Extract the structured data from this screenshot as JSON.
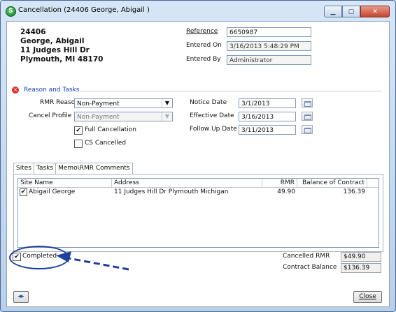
{
  "window": {
    "title": "Cancellation (24406 George, Abigail )",
    "app_icon_glyph": "S",
    "minimize_glyph": "▁",
    "maximize_glyph": "▢",
    "close_glyph": "✕"
  },
  "customer": {
    "id": "24406",
    "name": "George, Abigail",
    "address1": "11  Judges Hill Dr",
    "address2": "Plymouth, MI  48170"
  },
  "info": {
    "reference_label": "Reference",
    "reference_value": "6650987",
    "entered_on_label": "Entered On",
    "entered_on_value": "3/16/2013 5:48:29 PM",
    "entered_by_label": "Entered By",
    "entered_by_value": "Administrator"
  },
  "section": {
    "title": "Reason and Tasks",
    "error_icon_glyph": "✕"
  },
  "form": {
    "rmr_reason_label": "RMR Reason",
    "rmr_reason_value": "Non-Payment",
    "cancel_profile_label": "Cancel Profile",
    "cancel_profile_value": "Non-Payment",
    "full_cancellation_label": "Full Cancellation",
    "full_cancellation_checked": "✔",
    "cs_cancelled_label": "CS Cancelled",
    "notice_date_label": "Notice Date",
    "notice_date_value": "3/1/2013",
    "effective_date_label": "Effective Date",
    "effective_date_value": "3/16/2013",
    "follow_up_date_label": "Follow Up Date",
    "follow_up_date_value": "3/11/2013",
    "dropdown_glyph": "▼"
  },
  "tabs": [
    "Sites",
    "Tasks",
    "Memo\\RMR Comments"
  ],
  "sites_table": {
    "columns": [
      "Site Name",
      "Address",
      "RMR",
      "Balance of Contract"
    ],
    "rows": [
      {
        "checked": "✔",
        "site_name": "Abigail George",
        "address": "11  Judges Hill Dr Plymouth Michigan",
        "rmr": "49.90",
        "balance": "136.39"
      }
    ]
  },
  "completed": {
    "label": "Completed",
    "checked": "✔"
  },
  "summary": {
    "cancelled_rmr_label": "Cancelled RMR",
    "cancelled_rmr_value": "$49.90",
    "contract_balance_label": "Contract Balance",
    "contract_balance_value": "$136.39"
  },
  "buttons": {
    "nav_glyph": "◂▸",
    "close_label": "Close"
  },
  "colors": {
    "section_title": "#1b3fa8",
    "arrow": "#1e3f9a",
    "error_icon": "#d9342b"
  }
}
